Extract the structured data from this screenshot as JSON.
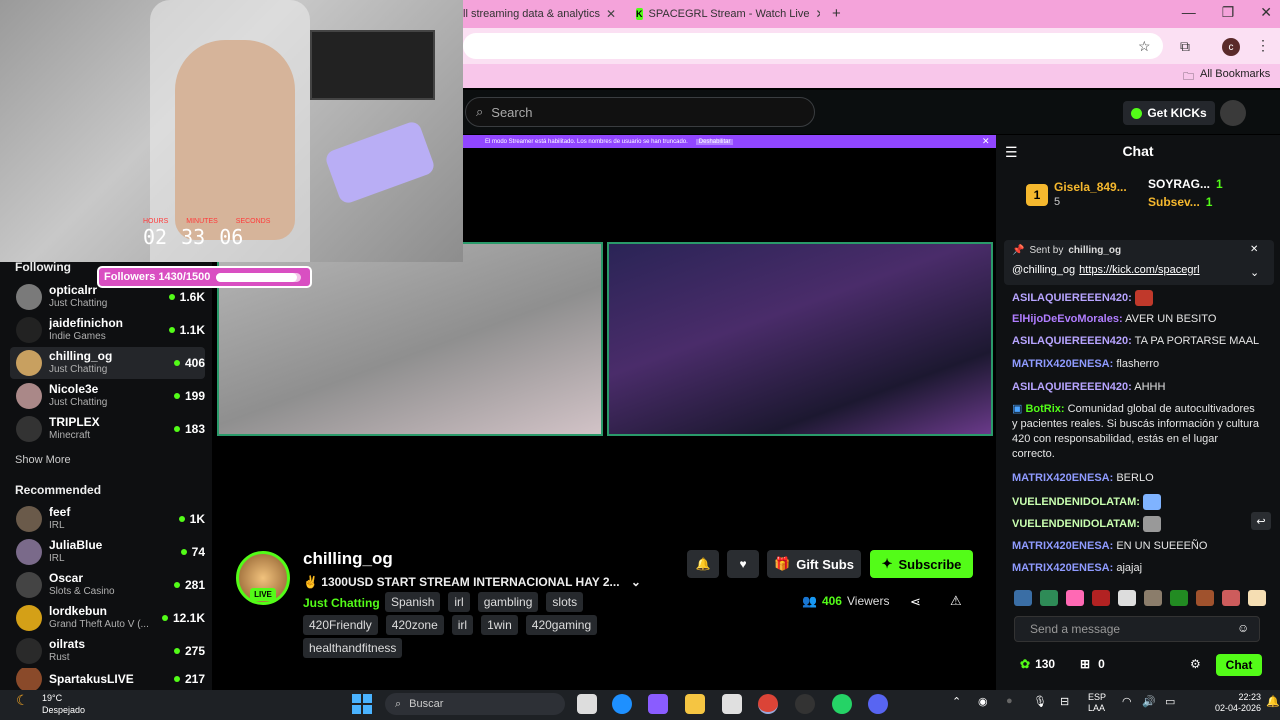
{
  "browser": {
    "tabs": [
      {
        "label": "ll streaming data & analytics"
      },
      {
        "label": "SPACEGRL Stream - Watch Live"
      }
    ],
    "new_tab": "+",
    "bookmarks_label": "All Bookmarks",
    "profile_initial": "c"
  },
  "header": {
    "search_placeholder": "Search",
    "get_kicks": "Get KICKs"
  },
  "banner": {
    "text": "El modo Streamer está habilitado. Los nombres de usuario se han truncado.",
    "action": "Deshabilitar"
  },
  "webcam": {
    "timer_labels": [
      "HOURS",
      "MINUTES",
      "SECONDS"
    ],
    "timer_values": [
      "02",
      "33",
      "06"
    ],
    "followers_text": "Followers 1430/1500",
    "followers_progress": 0.953
  },
  "sidebar": {
    "following_title": "Following",
    "following": [
      {
        "name": "opticalrr",
        "category": "Just Chatting",
        "viewers": "1.6K"
      },
      {
        "name": "jaidefinichon",
        "category": "Indie Games",
        "viewers": "1.1K"
      },
      {
        "name": "chilling_og",
        "category": "Just Chatting",
        "viewers": "406"
      },
      {
        "name": "Nicole3e",
        "category": "Just Chatting",
        "viewers": "199"
      },
      {
        "name": "TRIPLEX",
        "category": "Minecraft",
        "viewers": "183"
      }
    ],
    "show_more": "Show More",
    "recommended_title": "Recommended",
    "recommended": [
      {
        "name": "feef",
        "category": "IRL",
        "viewers": "1K"
      },
      {
        "name": "JuliaBlue",
        "category": "IRL",
        "viewers": "74"
      },
      {
        "name": "Oscar",
        "category": "Slots & Casino",
        "viewers": "281"
      },
      {
        "name": "lordkebun",
        "category": "Grand Theft Auto V (...",
        "viewers": "12.1K"
      },
      {
        "name": "oilrats",
        "category": "Rust",
        "viewers": "275"
      },
      {
        "name": "SpartakusLIVE",
        "category": "",
        "viewers": "217"
      }
    ]
  },
  "stream": {
    "name": "chilling_og",
    "live": "LIVE",
    "title": "✌ 1300USD START STREAM INTERNACIONAL HAY 2...",
    "category": "Just Chatting",
    "tags_row1": [
      "Spanish",
      "irl",
      "gambling",
      "slots"
    ],
    "tags_row2": [
      "420Friendly",
      "420zone",
      "irl",
      "1win",
      "420gaming"
    ],
    "tags_row3": [
      "healthandfitness"
    ],
    "gift_subs": "Gift Subs",
    "subscribe": "Subscribe",
    "viewers_count": "406",
    "viewers_label": "Viewers"
  },
  "chat": {
    "title": "Chat",
    "top_gifters": [
      {
        "name": "Gisela_849...",
        "count": "5"
      },
      {
        "name": "SOYRAG...",
        "count": "1"
      },
      {
        "name": "Subsev...",
        "count": "1"
      }
    ],
    "pinned_sent_by": "Sent by",
    "pinned_user": "chilling_og",
    "pinned_msg_user": "@chilling_og",
    "pinned_link": "https://kick.com/spacegrl",
    "messages": [
      {
        "user": "ASILAQUIEREEEN420:",
        "text": "",
        "color": "#b7a4ff"
      },
      {
        "user": "ElHijoDeEvoMorales:",
        "text": "AVER UN BESITO",
        "color": "#b07dff"
      },
      {
        "user": "ASILAQUIEREEEN420:",
        "text": "TA PA PORTARSE MAAL",
        "color": "#b7a4ff"
      },
      {
        "user": "MATRIX420ENESA:",
        "text": "flasherro",
        "color": "#8f9bff"
      },
      {
        "user": "ASILAQUIEREEEN420:",
        "text": "AHHH",
        "color": "#b7a4ff"
      },
      {
        "user": "BotRix:",
        "text": "Comunidad global de autocultivadores y pacientes reales. Si buscás información y cultura 420 con responsabilidad, estás en el lugar correcto.",
        "color": "#53fc18"
      },
      {
        "user": "MATRIX420ENESA:",
        "text": "BERLO",
        "color": "#8f9bff"
      },
      {
        "user": "VUELENDENIDOLATAM:",
        "text": "",
        "color": "#c9ffb0"
      },
      {
        "user": "VUELENDENIDOLATAM:",
        "text": "",
        "color": "#c9ffb0"
      },
      {
        "user": "MATRIX420ENESA:",
        "text": "EN UN SUEEEÑO",
        "color": "#8f9bff"
      },
      {
        "user": "MATRIX420ENESA:",
        "text": "ajajaj",
        "color": "#8f9bff"
      }
    ],
    "input_placeholder": "Send a message",
    "points": "130",
    "gift_count": "0",
    "send_label": "Chat"
  },
  "taskbar": {
    "weather_temp": "19°C",
    "weather_desc": "Despejado",
    "search": "Buscar",
    "lang1": "ESP",
    "lang2": "LAA",
    "time": "22:23",
    "date": "02-04-2026"
  },
  "colors": {
    "kick_green": "#53fc18",
    "tab_pink": "#f4a3da",
    "followers_pink": "#d94fc2"
  }
}
